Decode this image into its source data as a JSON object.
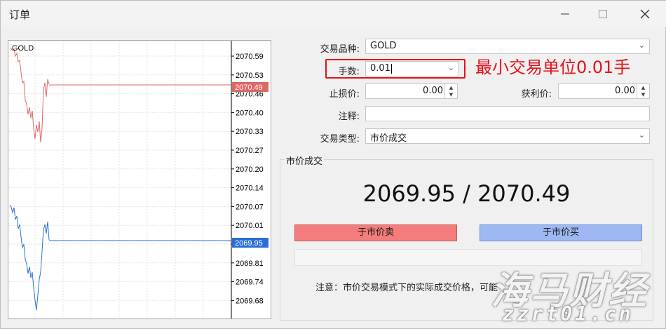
{
  "window": {
    "title": "订单"
  },
  "chart": {
    "symbol": "GOLD",
    "price_ticks": [
      "2070.59",
      "2070.53",
      "2070.46",
      "2070.40",
      "2070.33",
      "2070.27",
      "2070.20",
      "2070.14",
      "2070.07",
      "2070.01",
      "2069.87",
      "2069.81",
      "2069.74",
      "2069.68"
    ],
    "ask_label": "2070.49",
    "bid_label": "2069.95",
    "colors": {
      "ask": "#e06666",
      "bid": "#2a6fd6"
    }
  },
  "form": {
    "symbol_label": "交易品种:",
    "symbol_value": "GOLD",
    "volume_label": "手数:",
    "volume_value": "0.01",
    "stoploss_label": "止损价:",
    "stoploss_value": "0.00",
    "takeprofit_label": "获利价:",
    "takeprofit_value": "0.00",
    "comment_label": "注释:",
    "comment_value": "",
    "type_label": "交易类型:",
    "type_value": "市价成交"
  },
  "annotation": {
    "text": "最小交易单位0.01手",
    "color": "#e3121b"
  },
  "market": {
    "group_title": "市价成交",
    "prices": "2069.95 / 2070.49",
    "sell_label": "于市价卖",
    "buy_label": "于市价买",
    "note": "注意：市价交易模式下的实际成交价格，可能"
  },
  "watermark": {
    "line1": "海马财经",
    "line2": "zzrt01.cn"
  }
}
